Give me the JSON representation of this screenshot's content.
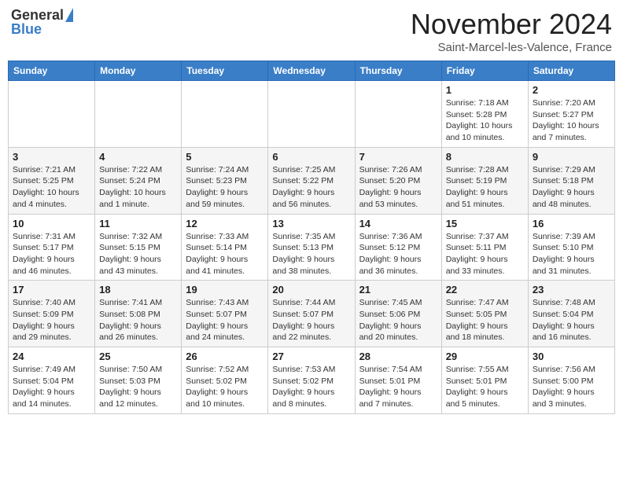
{
  "header": {
    "logo": {
      "general": "General",
      "blue": "Blue"
    },
    "month": "November 2024",
    "location": "Saint-Marcel-les-Valence, France"
  },
  "weekdays": [
    "Sunday",
    "Monday",
    "Tuesday",
    "Wednesday",
    "Thursday",
    "Friday",
    "Saturday"
  ],
  "weeks": [
    {
      "days": [
        {
          "num": "",
          "info": ""
        },
        {
          "num": "",
          "info": ""
        },
        {
          "num": "",
          "info": ""
        },
        {
          "num": "",
          "info": ""
        },
        {
          "num": "",
          "info": ""
        },
        {
          "num": "1",
          "info": "Sunrise: 7:18 AM\nSunset: 5:28 PM\nDaylight: 10 hours\nand 10 minutes."
        },
        {
          "num": "2",
          "info": "Sunrise: 7:20 AM\nSunset: 5:27 PM\nDaylight: 10 hours\nand 7 minutes."
        }
      ]
    },
    {
      "days": [
        {
          "num": "3",
          "info": "Sunrise: 7:21 AM\nSunset: 5:25 PM\nDaylight: 10 hours\nand 4 minutes."
        },
        {
          "num": "4",
          "info": "Sunrise: 7:22 AM\nSunset: 5:24 PM\nDaylight: 10 hours\nand 1 minute."
        },
        {
          "num": "5",
          "info": "Sunrise: 7:24 AM\nSunset: 5:23 PM\nDaylight: 9 hours\nand 59 minutes."
        },
        {
          "num": "6",
          "info": "Sunrise: 7:25 AM\nSunset: 5:22 PM\nDaylight: 9 hours\nand 56 minutes."
        },
        {
          "num": "7",
          "info": "Sunrise: 7:26 AM\nSunset: 5:20 PM\nDaylight: 9 hours\nand 53 minutes."
        },
        {
          "num": "8",
          "info": "Sunrise: 7:28 AM\nSunset: 5:19 PM\nDaylight: 9 hours\nand 51 minutes."
        },
        {
          "num": "9",
          "info": "Sunrise: 7:29 AM\nSunset: 5:18 PM\nDaylight: 9 hours\nand 48 minutes."
        }
      ]
    },
    {
      "days": [
        {
          "num": "10",
          "info": "Sunrise: 7:31 AM\nSunset: 5:17 PM\nDaylight: 9 hours\nand 46 minutes."
        },
        {
          "num": "11",
          "info": "Sunrise: 7:32 AM\nSunset: 5:15 PM\nDaylight: 9 hours\nand 43 minutes."
        },
        {
          "num": "12",
          "info": "Sunrise: 7:33 AM\nSunset: 5:14 PM\nDaylight: 9 hours\nand 41 minutes."
        },
        {
          "num": "13",
          "info": "Sunrise: 7:35 AM\nSunset: 5:13 PM\nDaylight: 9 hours\nand 38 minutes."
        },
        {
          "num": "14",
          "info": "Sunrise: 7:36 AM\nSunset: 5:12 PM\nDaylight: 9 hours\nand 36 minutes."
        },
        {
          "num": "15",
          "info": "Sunrise: 7:37 AM\nSunset: 5:11 PM\nDaylight: 9 hours\nand 33 minutes."
        },
        {
          "num": "16",
          "info": "Sunrise: 7:39 AM\nSunset: 5:10 PM\nDaylight: 9 hours\nand 31 minutes."
        }
      ]
    },
    {
      "days": [
        {
          "num": "17",
          "info": "Sunrise: 7:40 AM\nSunset: 5:09 PM\nDaylight: 9 hours\nand 29 minutes."
        },
        {
          "num": "18",
          "info": "Sunrise: 7:41 AM\nSunset: 5:08 PM\nDaylight: 9 hours\nand 26 minutes."
        },
        {
          "num": "19",
          "info": "Sunrise: 7:43 AM\nSunset: 5:07 PM\nDaylight: 9 hours\nand 24 minutes."
        },
        {
          "num": "20",
          "info": "Sunrise: 7:44 AM\nSunset: 5:07 PM\nDaylight: 9 hours\nand 22 minutes."
        },
        {
          "num": "21",
          "info": "Sunrise: 7:45 AM\nSunset: 5:06 PM\nDaylight: 9 hours\nand 20 minutes."
        },
        {
          "num": "22",
          "info": "Sunrise: 7:47 AM\nSunset: 5:05 PM\nDaylight: 9 hours\nand 18 minutes."
        },
        {
          "num": "23",
          "info": "Sunrise: 7:48 AM\nSunset: 5:04 PM\nDaylight: 9 hours\nand 16 minutes."
        }
      ]
    },
    {
      "days": [
        {
          "num": "24",
          "info": "Sunrise: 7:49 AM\nSunset: 5:04 PM\nDaylight: 9 hours\nand 14 minutes."
        },
        {
          "num": "25",
          "info": "Sunrise: 7:50 AM\nSunset: 5:03 PM\nDaylight: 9 hours\nand 12 minutes."
        },
        {
          "num": "26",
          "info": "Sunrise: 7:52 AM\nSunset: 5:02 PM\nDaylight: 9 hours\nand 10 minutes."
        },
        {
          "num": "27",
          "info": "Sunrise: 7:53 AM\nSunset: 5:02 PM\nDaylight: 9 hours\nand 8 minutes."
        },
        {
          "num": "28",
          "info": "Sunrise: 7:54 AM\nSunset: 5:01 PM\nDaylight: 9 hours\nand 7 minutes."
        },
        {
          "num": "29",
          "info": "Sunrise: 7:55 AM\nSunset: 5:01 PM\nDaylight: 9 hours\nand 5 minutes."
        },
        {
          "num": "30",
          "info": "Sunrise: 7:56 AM\nSunset: 5:00 PM\nDaylight: 9 hours\nand 3 minutes."
        }
      ]
    }
  ]
}
